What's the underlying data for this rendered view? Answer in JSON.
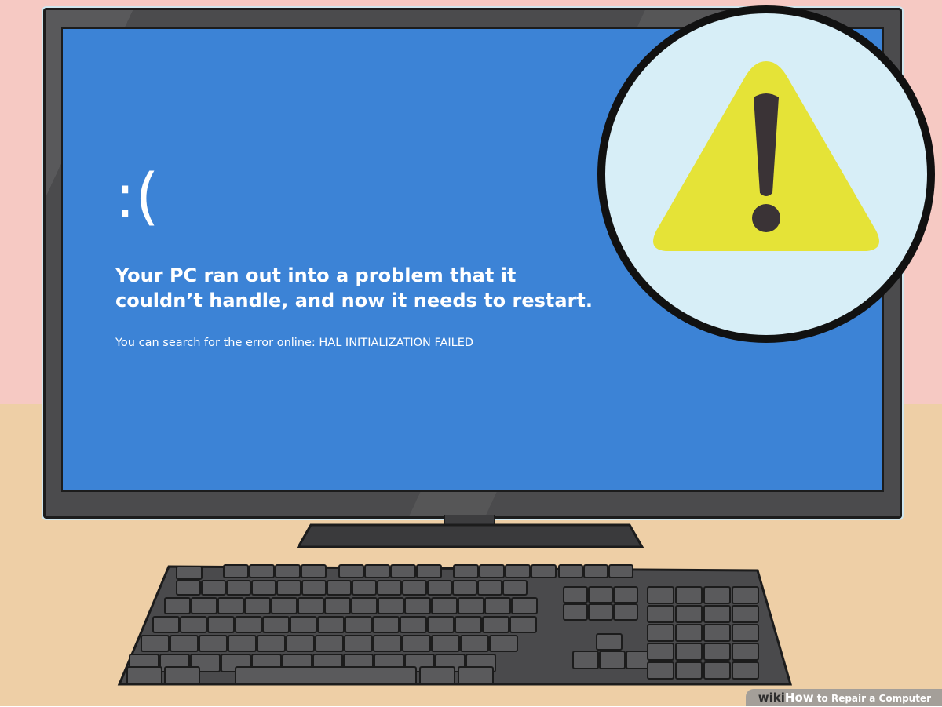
{
  "colors": {
    "wall": "#f6c9c3",
    "desk": "#eecfa6",
    "screen": "#3c83d6",
    "warning_circle": "#d7eef7",
    "warning_triangle": "#e5e337",
    "bezel": "#4b4b4d",
    "keyboard": "#4a4a4c",
    "key": "#5a5a5c"
  },
  "bsod": {
    "emoticon": ":(",
    "headline": "Your PC ran out into a problem that it couldn’t handle, and now it needs to restart.",
    "search_hint": "You can search for the error online: HAL INITIALIZATION FAILED"
  },
  "warning": {
    "icon": "warning-triangle-icon",
    "glyph": "!"
  },
  "footer": {
    "brand_wiki": "wiki",
    "brand_how": "How",
    "title": " to Repair a Computer"
  }
}
